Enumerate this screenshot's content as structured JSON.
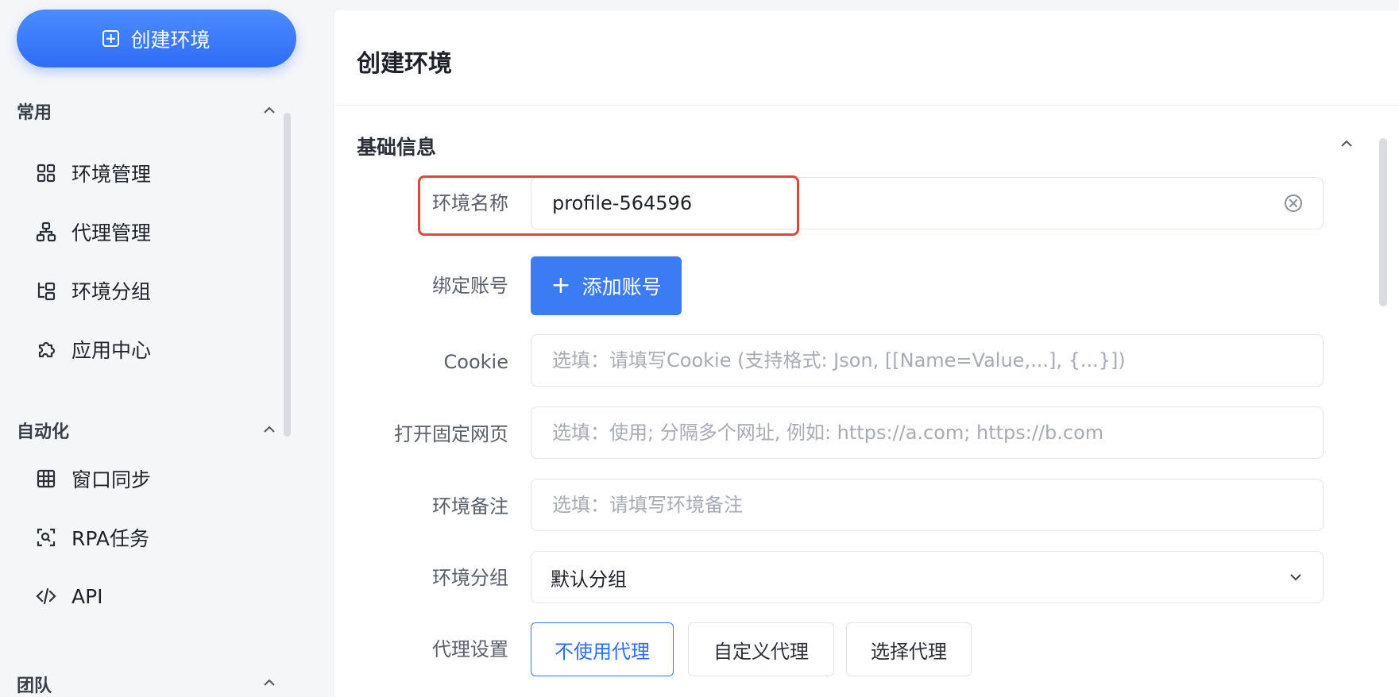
{
  "sidebar": {
    "create_button": "创建环境",
    "sections": [
      {
        "title": "常用",
        "items": [
          {
            "label": "环境管理",
            "icon": "grid-icon"
          },
          {
            "label": "代理管理",
            "icon": "network-icon"
          },
          {
            "label": "环境分组",
            "icon": "group-icon"
          },
          {
            "label": "应用中心",
            "icon": "puzzle-icon"
          }
        ]
      },
      {
        "title": "自动化",
        "items": [
          {
            "label": "窗口同步",
            "icon": "table-icon"
          },
          {
            "label": "RPA任务",
            "icon": "scan-icon"
          },
          {
            "label": "API",
            "icon": "code-icon"
          }
        ]
      },
      {
        "title": "团队",
        "items": []
      }
    ]
  },
  "main": {
    "title": "创建环境",
    "section_title": "基础信息",
    "form": {
      "name_label": "环境名称",
      "name_value": "profile-564596",
      "account_label": "绑定账号",
      "account_button": "添加账号",
      "cookie_label": "Cookie",
      "cookie_placeholder": "选填：请填写Cookie (支持格式: Json, [[Name=Value,...], {...}])",
      "url_label": "打开固定网页",
      "url_placeholder": "选填：使用; 分隔多个网址, 例如: https://a.com; https://b.com",
      "note_label": "环境备注",
      "note_placeholder": "选填：请填写环境备注",
      "group_label": "环境分组",
      "group_value": "默认分组",
      "proxy_label": "代理设置",
      "proxy_options": [
        "不使用代理",
        "自定义代理",
        "选择代理"
      ],
      "proxy_selected": "不使用代理"
    }
  },
  "colors": {
    "primary": "#3b7cf5",
    "highlight_border": "#d94a3a"
  }
}
